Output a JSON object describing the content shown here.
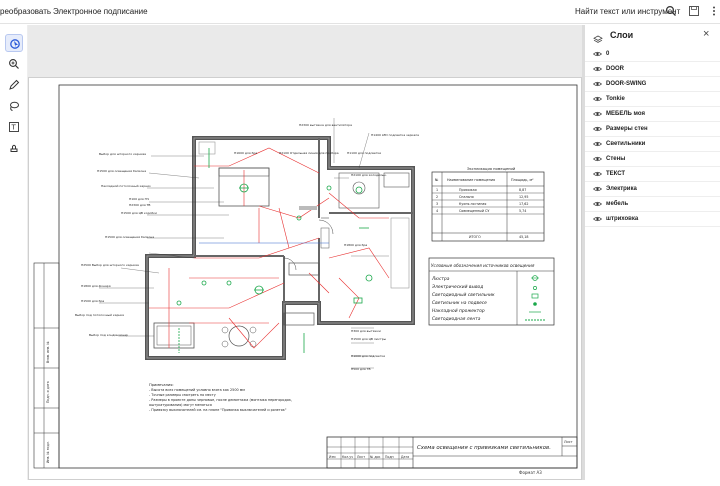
{
  "toolbar": {
    "convert_label": "реобразовать",
    "esign_label": "Электронное подписание",
    "find_label": "Найти текст или инструмент"
  },
  "icons": {
    "search": "search-icon",
    "save": "save-icon",
    "more": "more-vertical-icon",
    "close": "close-icon",
    "eye": "eye-icon"
  },
  "layers_panel": {
    "title": "Слои",
    "close_glyph": "×",
    "items": [
      {
        "name": "0"
      },
      {
        "name": "DOOR"
      },
      {
        "name": "DOOR-SWING"
      },
      {
        "name": "Tonkie"
      },
      {
        "name": "МЕБЕЛЬ моя"
      },
      {
        "name": "Размеры стен"
      },
      {
        "name": "Светильники"
      },
      {
        "name": "Стены"
      },
      {
        "name": "ТЕКСТ"
      },
      {
        "name": "Электрика"
      },
      {
        "name": "мебель"
      },
      {
        "name": "штриховка"
      }
    ]
  },
  "drawing": {
    "explication_title": "Экспликация помещений",
    "explication_headers": [
      "№",
      "Наименование помещения",
      "Площадь, м²"
    ],
    "explication_rows": [
      [
        "1",
        "Прихожая",
        "8,87"
      ],
      [
        "2",
        "Спальня",
        "12,95"
      ],
      [
        "3",
        "Кухня-гостиная",
        "17,62"
      ],
      [
        "4",
        "Совмещенный СУ",
        "5,74"
      ]
    ],
    "explication_total_label": "ИТОГО",
    "explication_total_value": "45,18",
    "legend_title": "Условные обозначения источников освещения",
    "legend_items": [
      "Люстра",
      "Электрический вывод",
      "Светодиодный светильник",
      "Светильник на подвесе",
      "Накладной прожектор",
      "Светодиодная лента"
    ],
    "notes_title": "Примечания:",
    "notes": [
      "- Высота всех помещений условно взята как 2500 мм",
      "- Точные размеры смотреть по месту",
      "- Размеры в проекте даны черновые, после демонтажа (монтажа перегородок,",
      "  оштукатуривания) могут меняться",
      "- Привязку выключателей см. на плане \"Привязка выключателей и розеток\""
    ],
    "stamp_title": "Схема освещения с привязками светильников.",
    "stamp_format": "Формат А3",
    "stamp_cols": [
      "Изм",
      "Кол.уч",
      "Лист",
      "№ док",
      "Подп",
      "Дата"
    ],
    "stamp_sheet": "Лист",
    "side_labels": [
      "Взам. инв. №",
      "Подп. и дата",
      "Инв. № подл."
    ],
    "annotations_left": [
      "Выбор для шторного карниза",
      "Н1500 для освещения балкона",
      "Накладной потолочный карниз",
      "Н100 для ПЧ",
      "Н2300 для ТВ",
      "Н1500 для ЦВ коробки",
      "Н1500 для освещения балкона",
      "Н2500 Выбор для шторного карниза",
      "Н1800 для фонаря",
      "Н1500 для бра",
      "Выбор под потолочный карниз",
      "Выбор под кондиционер"
    ],
    "annotations_right": [
      "Н1600 для бра",
      "Н2100 Отдельная линия для прибора",
      "Н2300 вытяжка для вентилятора",
      "Н1400 LED подсветка зеркала",
      "Н1100 для подсветки",
      "Н2100 для холодильн.",
      "Н1500 для ЦВ люстры",
      "Н1000 для подсветки",
      "Н500 для ТВ",
      "Н1800 для бра",
      "Н300 для вытяжки"
    ]
  }
}
